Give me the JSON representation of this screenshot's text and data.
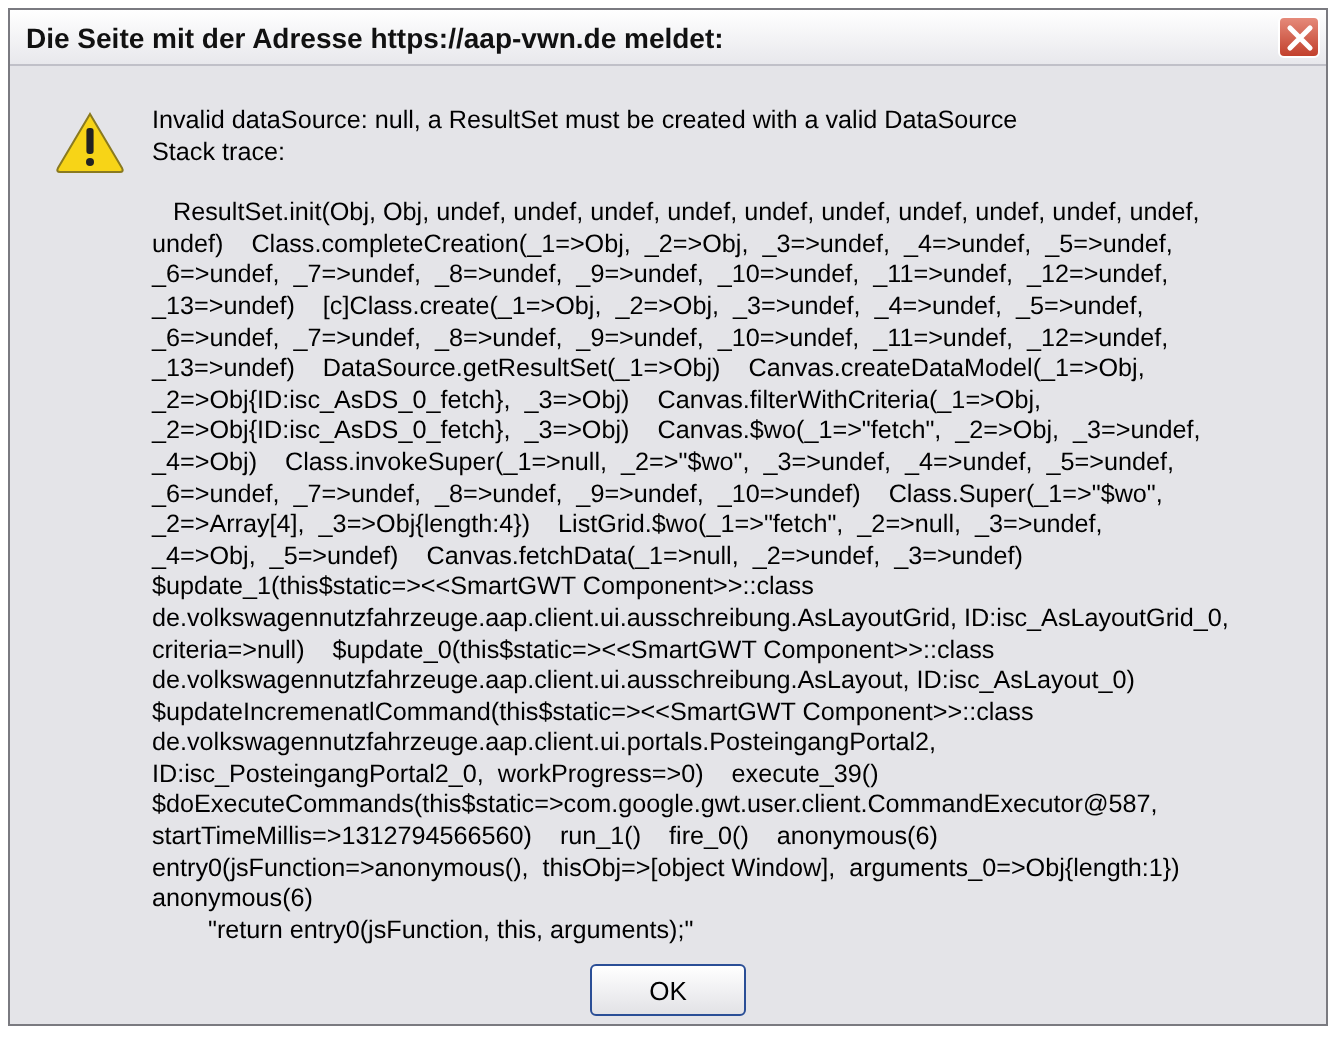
{
  "window": {
    "title": "Die Seite mit der Adresse https://aap-vwn.de meldet:"
  },
  "message": [
    "Invalid dataSource: null, a ResultSet must be created with a valid DataSource",
    "Stack trace:"
  ],
  "stack_trace": [
    "   ResultSet.init(Obj, Obj, undef, undef, undef, undef, undef, undef, undef, undef, undef, undef,",
    "undef)    Class.completeCreation(_1=>Obj,  _2=>Obj,  _3=>undef,  _4=>undef,  _5=>undef,",
    "_6=>undef,  _7=>undef,  _8=>undef,  _9=>undef,  _10=>undef,  _11=>undef,  _12=>undef,",
    "_13=>undef)    [c]Class.create(_1=>Obj,  _2=>Obj,  _3=>undef,  _4=>undef,  _5=>undef,",
    "_6=>undef,  _7=>undef,  _8=>undef,  _9=>undef,  _10=>undef,  _11=>undef,  _12=>undef,",
    "_13=>undef)    DataSource.getResultSet(_1=>Obj)    Canvas.createDataModel(_1=>Obj,",
    "_2=>Obj{ID:isc_AsDS_0_fetch},  _3=>Obj)    Canvas.filterWithCriteria(_1=>Obj,",
    "_2=>Obj{ID:isc_AsDS_0_fetch},  _3=>Obj)    Canvas.$wo(_1=>\"fetch\",  _2=>Obj,  _3=>undef,",
    "_4=>Obj)    Class.invokeSuper(_1=>null,  _2=>\"$wo\",  _3=>undef,  _4=>undef,  _5=>undef,",
    "_6=>undef,  _7=>undef,  _8=>undef,  _9=>undef,  _10=>undef)    Class.Super(_1=>\"$wo\",",
    "_2=>Array[4],  _3=>Obj{length:4})    ListGrid.$wo(_1=>\"fetch\",  _2=>null,  _3=>undef,",
    "_4=>Obj,  _5=>undef)    Canvas.fetchData(_1=>null,  _2=>undef,  _3=>undef)",
    "$update_1(this$static=><<SmartGWT Component>>::class",
    "de.volkswagennutzfahrzeuge.aap.client.ui.ausschreibung.AsLayoutGrid, ID:isc_AsLayoutGrid_0,",
    "criteria=>null)    $update_0(this$static=><<SmartGWT Component>>::class",
    "de.volkswagennutzfahrzeuge.aap.client.ui.ausschreibung.AsLayout, ID:isc_AsLayout_0)",
    "$updateIncremenatlCommand(this$static=><<SmartGWT Component>>::class",
    "de.volkswagennutzfahrzeuge.aap.client.ui.portals.PosteingangPortal2,",
    "ID:isc_PosteingangPortal2_0,  workProgress=>0)    execute_39()",
    "$doExecuteCommands(this$static=>com.google.gwt.user.client.CommandExecutor@587,",
    "startTimeMillis=>1312794566560)    run_1()    fire_0()    anonymous(6)",
    "entry0(jsFunction=>anonymous(),  thisObj=>[object Window],  arguments_0=>Obj{length:1})",
    "anonymous(6)",
    "        \"return entry0(jsFunction, this, arguments);\""
  ],
  "buttons": [
    "OK"
  ]
}
